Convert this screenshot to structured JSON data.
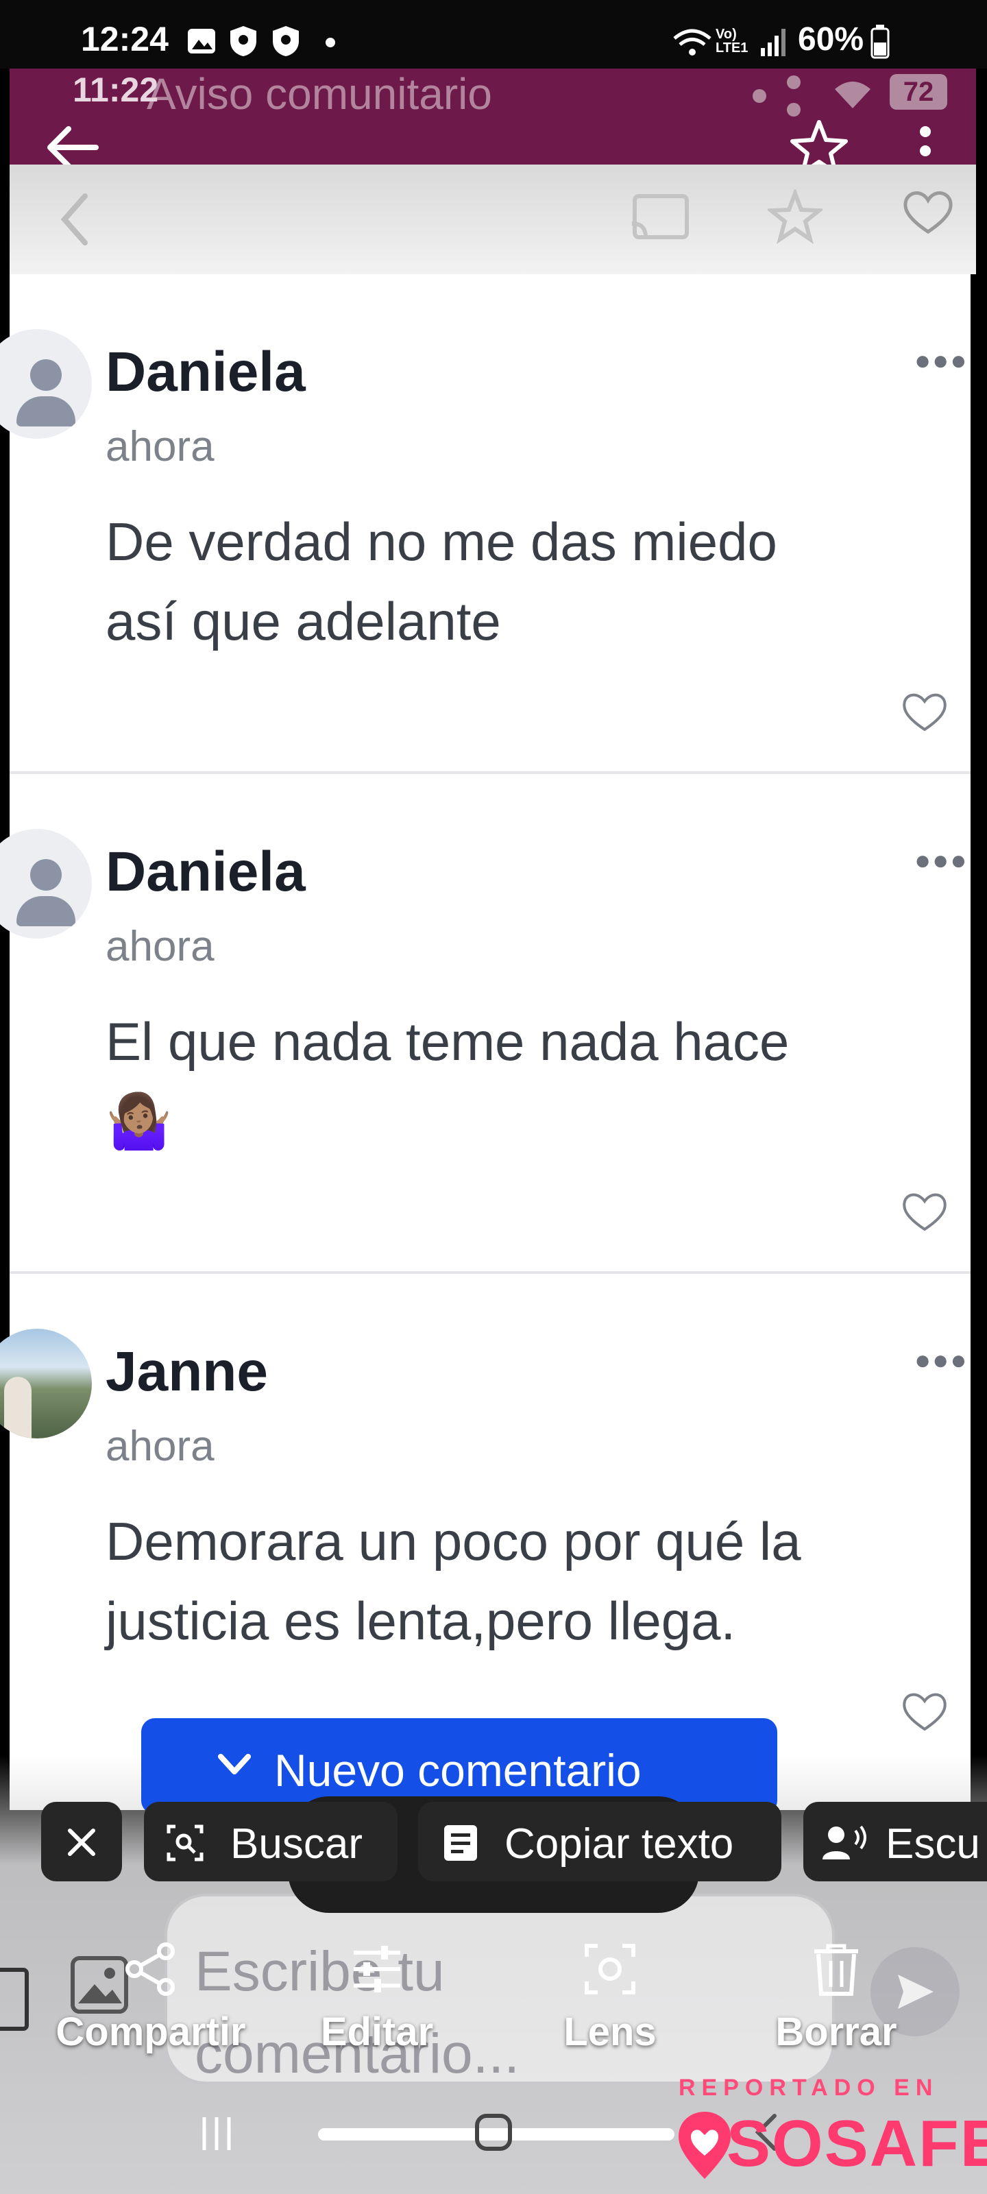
{
  "status_bar": {
    "time": "12:24",
    "network": "Vo) LTE1",
    "battery": "60%"
  },
  "inner_header": {
    "title": "Aviso comunitario",
    "time": "11:22",
    "badge": "72"
  },
  "comments": [
    {
      "author": "Daniela",
      "time": "ahora",
      "text_line1": "De verdad no me das miedo",
      "text_line2": "así que adelante",
      "avatar": "default-avatar-icon"
    },
    {
      "author": "Daniela",
      "time": "ahora",
      "text_line1": "El que nada teme nada hace",
      "text_line2": "🤷🏽‍♀️",
      "avatar": "default-avatar-icon"
    },
    {
      "author": "Janne",
      "time": "ahora",
      "text_line1": "Demorara un poco por qué la",
      "text_line2": "justicia es lenta,pero llega.",
      "avatar": "photo-avatar"
    }
  ],
  "new_comment_button": "Nuevo comentario",
  "composer_placeholder": "Escribe tu comentario...",
  "composer_line1": "Escribe tu",
  "composer_line2": "comentario...",
  "chips": {
    "buscar": "Buscar",
    "copiar": "Copiar texto",
    "escuchar": "Escu"
  },
  "actions": {
    "share": "Compartir",
    "edit": "Editar",
    "lens": "Lens",
    "delete": "Borrar"
  },
  "watermark": {
    "reported": "REPORTADO EN",
    "brand": "SOSAFE"
  },
  "colors": {
    "header": "#6d1a4a",
    "primary_button": "#1450e8",
    "brand": "#ff3a6e"
  }
}
